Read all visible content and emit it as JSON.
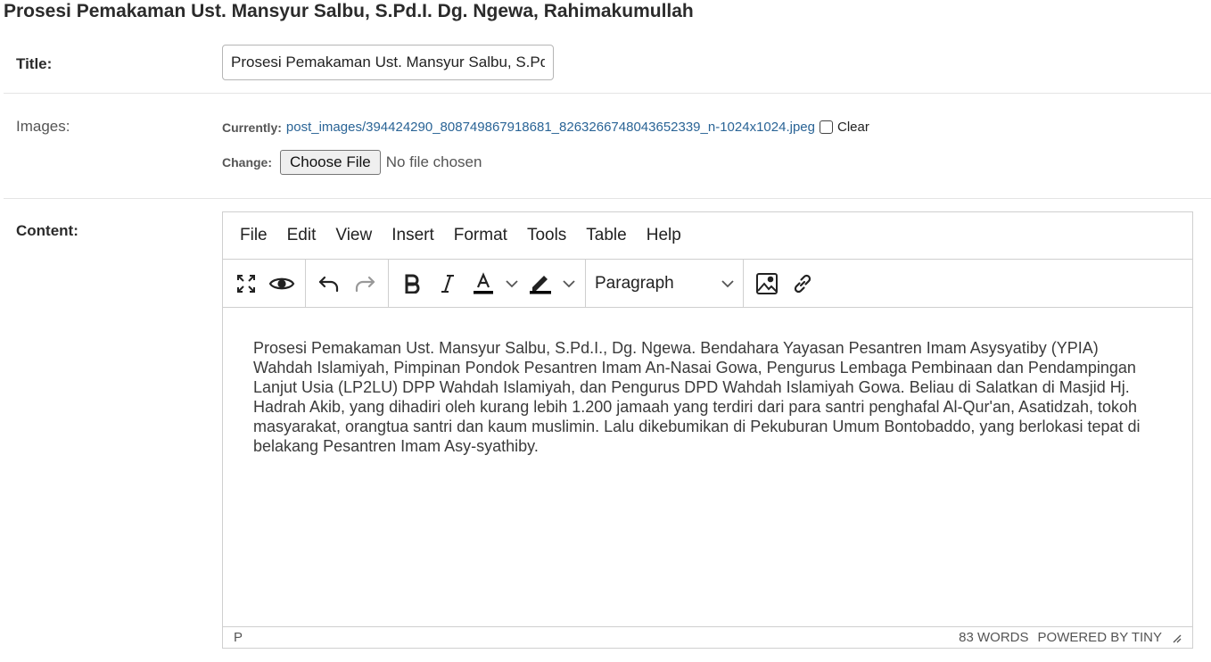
{
  "page": {
    "title": "Prosesi Pemakaman Ust. Mansyur Salbu, S.Pd.I. Dg. Ngewa, Rahimakumullah"
  },
  "fields": {
    "title": {
      "label": "Title:",
      "value": "Prosesi Pemakaman Ust. Mansyur Salbu, S.Pd.I. Dg. Ngewa, Rahimakumullah"
    },
    "images": {
      "label": "Images:",
      "currently_label": "Currently:",
      "current_file": "post_images/394424290_808749867918681_8263266748043652339_n-1024x1024.jpeg",
      "clear_label": "Clear",
      "change_label": "Change:",
      "choose_button": "Choose File",
      "no_file_text": "No file chosen"
    },
    "content": {
      "label": "Content:"
    }
  },
  "editor": {
    "menu": [
      "File",
      "Edit",
      "View",
      "Insert",
      "Format",
      "Tools",
      "Table",
      "Help"
    ],
    "toolbar_icons": [
      "fullscreen-icon",
      "preview-icon",
      "undo-icon",
      "redo-icon",
      "bold-icon",
      "italic-icon",
      "text-color-icon",
      "highlight-icon",
      "image-icon",
      "link-icon"
    ],
    "block_format": "Paragraph",
    "body_text": "Prosesi Pemakaman Ust. Mansyur Salbu, S.Pd.I., Dg. Ngewa. Bendahara Yayasan Pesantren Imam Asysyatiby (YPIA) Wahdah Islamiyah, Pimpinan Pondok Pesantren Imam An-Nasai Gowa, Pengurus Lembaga Pembinaan dan Pendampingan Lanjut Usia (LP2LU) DPP Wahdah Islamiyah, dan Pengurus DPD Wahdah Islamiyah Gowa. Beliau di Salatkan di Masjid Hj. Hadrah Akib, yang dihadiri oleh kurang lebih 1.200 jamaah yang terdiri dari para santri penghafal Al-Qur'an, Asatidzah, tokoh masyarakat, orangtua santri dan kaum muslimin. Lalu dikebumikan di Pekuburan Umum Bontobaddo, yang berlokasi tepat di belakang Pesantren Imam Asy-syathiby.",
    "status": {
      "path": "P",
      "word_count": "83 WORDS",
      "powered_by": "POWERED BY TINY"
    }
  },
  "colors": {
    "link": "#2a6496",
    "text_color_swatch": "#000000",
    "border": "#cfcfcf"
  }
}
